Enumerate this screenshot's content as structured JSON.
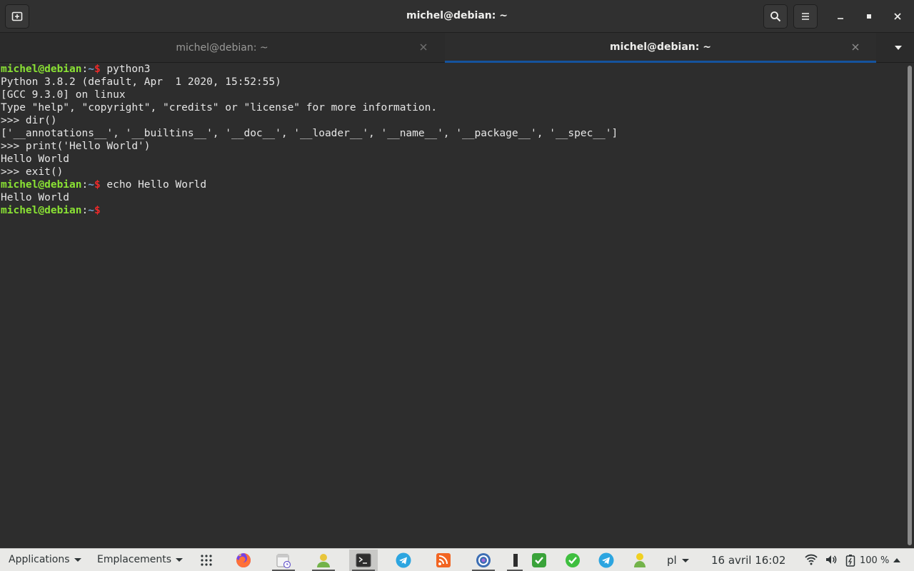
{
  "window": {
    "title": "michel@debian: ~"
  },
  "tabs": [
    {
      "label": "michel@debian: ~",
      "active": false
    },
    {
      "label": "michel@debian: ~",
      "active": true
    }
  ],
  "terminal": {
    "prompt": {
      "user_host": "michel@debian",
      "sep": ":",
      "path": "~",
      "dollar": "$"
    },
    "lines": [
      {
        "prompt": true,
        "text": " python3"
      },
      {
        "prompt": false,
        "text": "Python 3.8.2 (default, Apr  1 2020, 15:52:55)"
      },
      {
        "prompt": false,
        "text": "[GCC 9.3.0] on linux"
      },
      {
        "prompt": false,
        "text": "Type \"help\", \"copyright\", \"credits\" or \"license\" for more information."
      },
      {
        "prompt": false,
        "text": ">>> dir()"
      },
      {
        "prompt": false,
        "text": "['__annotations__', '__builtins__', '__doc__', '__loader__', '__name__', '__package__', '__spec__']"
      },
      {
        "prompt": false,
        "text": ">>> print('Hello World')"
      },
      {
        "prompt": false,
        "text": "Hello World"
      },
      {
        "prompt": false,
        "text": ">>> exit()"
      },
      {
        "prompt": true,
        "text": " echo Hello World"
      },
      {
        "prompt": false,
        "text": "Hello World"
      },
      {
        "prompt": true,
        "text": ""
      }
    ]
  },
  "panel": {
    "applications_label": "Applications",
    "places_label": "Emplacements",
    "keyboard_layout": "pl",
    "clock": "16 avril  16:02",
    "battery": "100 %",
    "taskbar": [
      "firefox-icon",
      "calendar-reminder-icon",
      "user-status-icon",
      "terminal-icon",
      "telegram-icon",
      "rss-icon",
      "fedora-icon",
      "window-thumbnail-icon",
      "checkmark-green-icon",
      "checkmark-green-icon",
      "telegram-icon",
      "pidgin-icon"
    ]
  },
  "colors": {
    "accent": "#15539e",
    "prompt_user": "#8ae234",
    "prompt_path": "#729fcf",
    "prompt_dollar": "#ef2929"
  }
}
